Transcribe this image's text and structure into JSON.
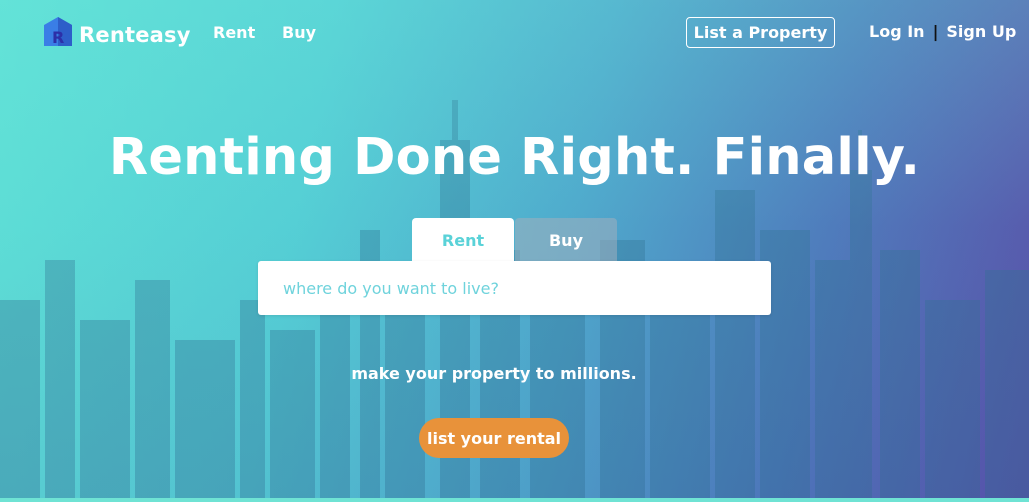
{
  "brand": {
    "name": "Renteasy",
    "logo_letter": "R"
  },
  "nav": {
    "rent": "Rent",
    "buy": "Buy",
    "list_property": "List a Property",
    "login": "Log In",
    "separator": "|",
    "signup": "Sign Up"
  },
  "hero": {
    "headline": "Renting Done Right. Finally.",
    "tabs": [
      {
        "label": "Rent",
        "active": true
      },
      {
        "label": "Buy",
        "active": false
      }
    ],
    "search_placeholder": "where do you want to live?",
    "tagline": "make your property to millions.",
    "cta": "list your rental"
  },
  "colors": {
    "accent_orange": "#e8923a",
    "teal": "#5fe0d6",
    "purple": "#5a4fa8",
    "placeholder_teal": "#6fd3dc"
  },
  "icons": {
    "logo": "house-logo-icon"
  }
}
